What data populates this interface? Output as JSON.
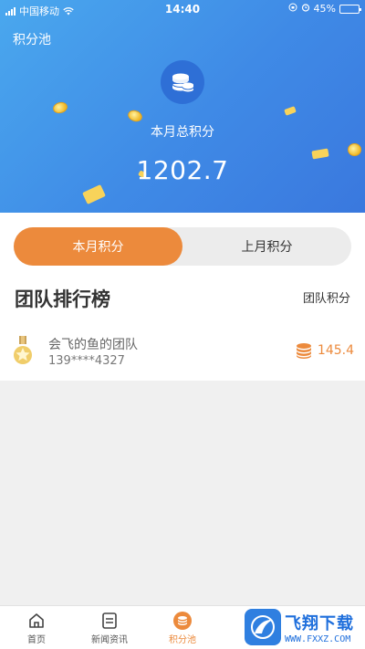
{
  "status_bar": {
    "carrier": "中国移动",
    "time": "14:40",
    "battery": "45%",
    "battery_level": 0.45
  },
  "header": {
    "title": "积分池",
    "icon": "coin-stack-icon",
    "monthly_label": "本月总积分",
    "monthly_value": "1202.7"
  },
  "tabs": [
    {
      "label": "本月积分",
      "active": true
    },
    {
      "label": "上月积分",
      "active": false
    }
  ],
  "ranking": {
    "title": "团队排行榜",
    "column_label": "团队积分",
    "rows": [
      {
        "name": "会飞的鱼的团队",
        "phone": "139****4327",
        "score": "145.4",
        "icon": "medal-icon"
      }
    ]
  },
  "bottom_nav": [
    {
      "label": "首页",
      "icon": "home-icon",
      "active": false
    },
    {
      "label": "新闻资讯",
      "icon": "news-icon",
      "active": false
    },
    {
      "label": "积分池",
      "icon": "coin-pool-icon",
      "active": true
    }
  ],
  "watermark": {
    "main": "飞翔下载",
    "sub": "WWW.FXXZ.COM"
  },
  "colors": {
    "accent": "#ec8a3c",
    "header_blue": "#3f8ae6"
  }
}
